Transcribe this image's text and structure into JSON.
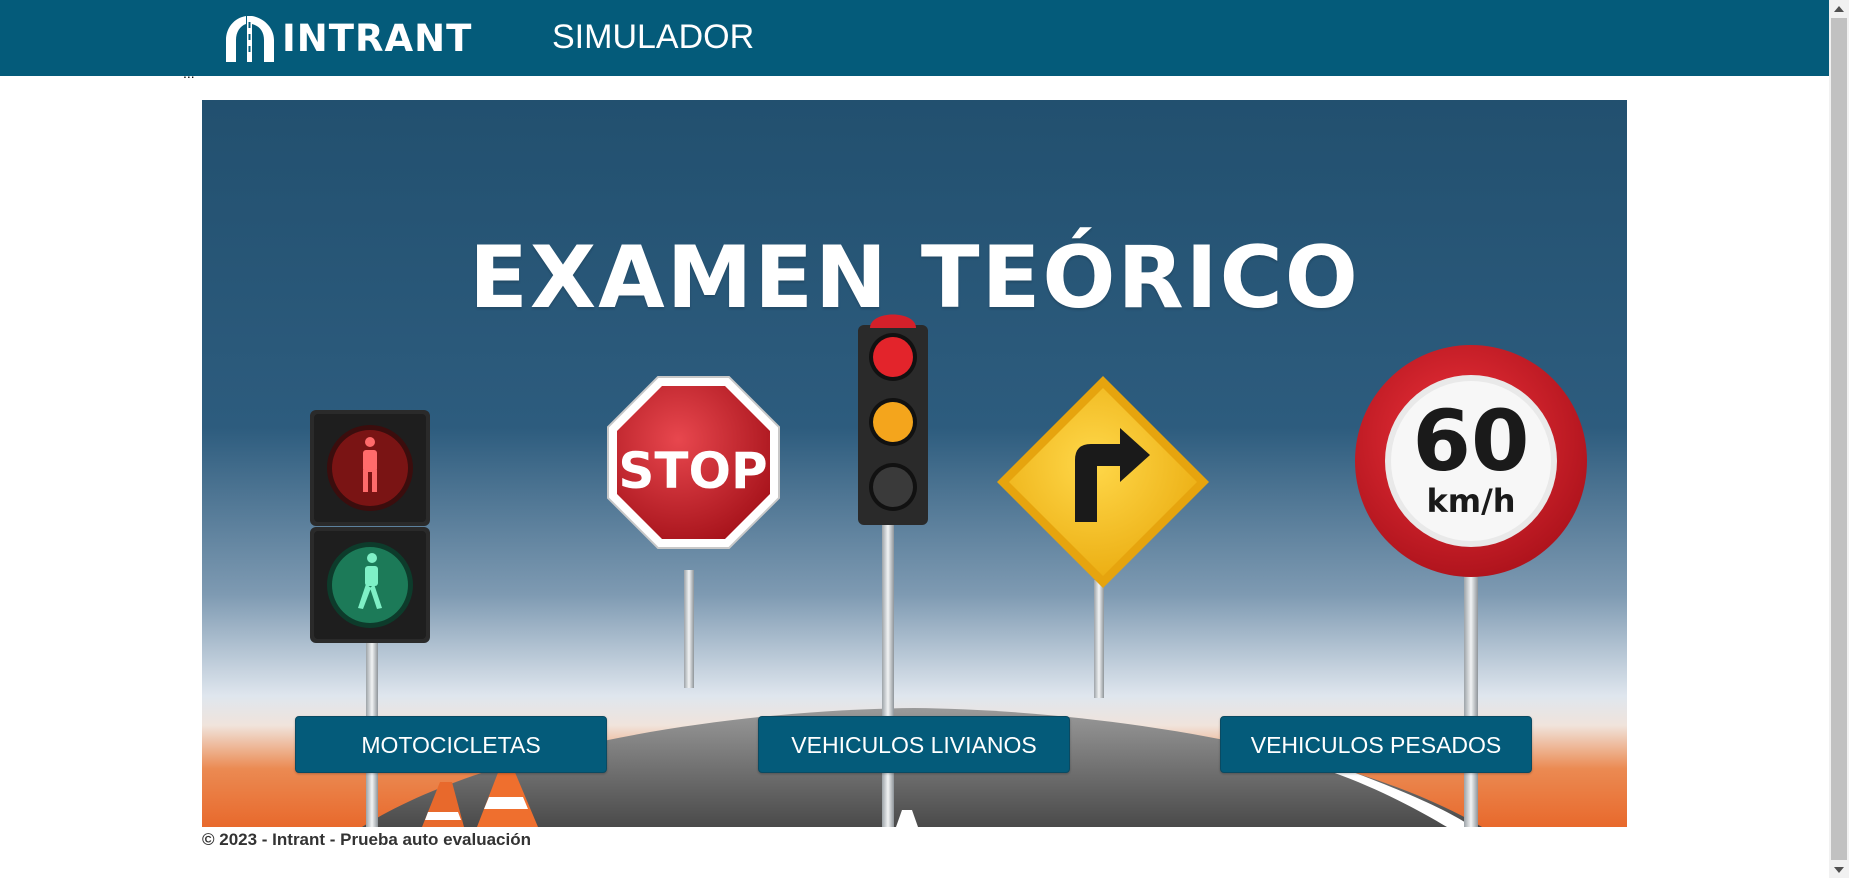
{
  "header": {
    "logo_text": "INTRANT",
    "nav_title": "SIMULADOR",
    "ellipsis": "..."
  },
  "banner": {
    "title": "EXAMEN TEÓRICO",
    "stop_sign_text": "STOP",
    "speed_value": "60",
    "speed_unit": "km/h"
  },
  "buttons": {
    "motorcycles": "MOTOCICLETAS",
    "light_vehicles": "VEHICULOS LIVIANOS",
    "heavy_vehicles": "VEHICULOS PESADOS"
  },
  "footer": {
    "text": "© 2023 - Intrant - Prueba auto evaluación"
  },
  "colors": {
    "header_bg": "#045b7a",
    "button_bg": "#045b7a",
    "banner_sky_top": "#22506f",
    "banner_ground": "#e8692c"
  },
  "icons": {
    "logo": "intrant-road-logo-icon",
    "pedestrian_light": "pedestrian-traffic-light-icon",
    "stop": "stop-sign-icon",
    "traffic_light": "traffic-light-icon",
    "curve": "right-curve-warning-sign-icon",
    "speed_limit": "speed-limit-sign-icon",
    "cone": "traffic-cone-icon"
  }
}
